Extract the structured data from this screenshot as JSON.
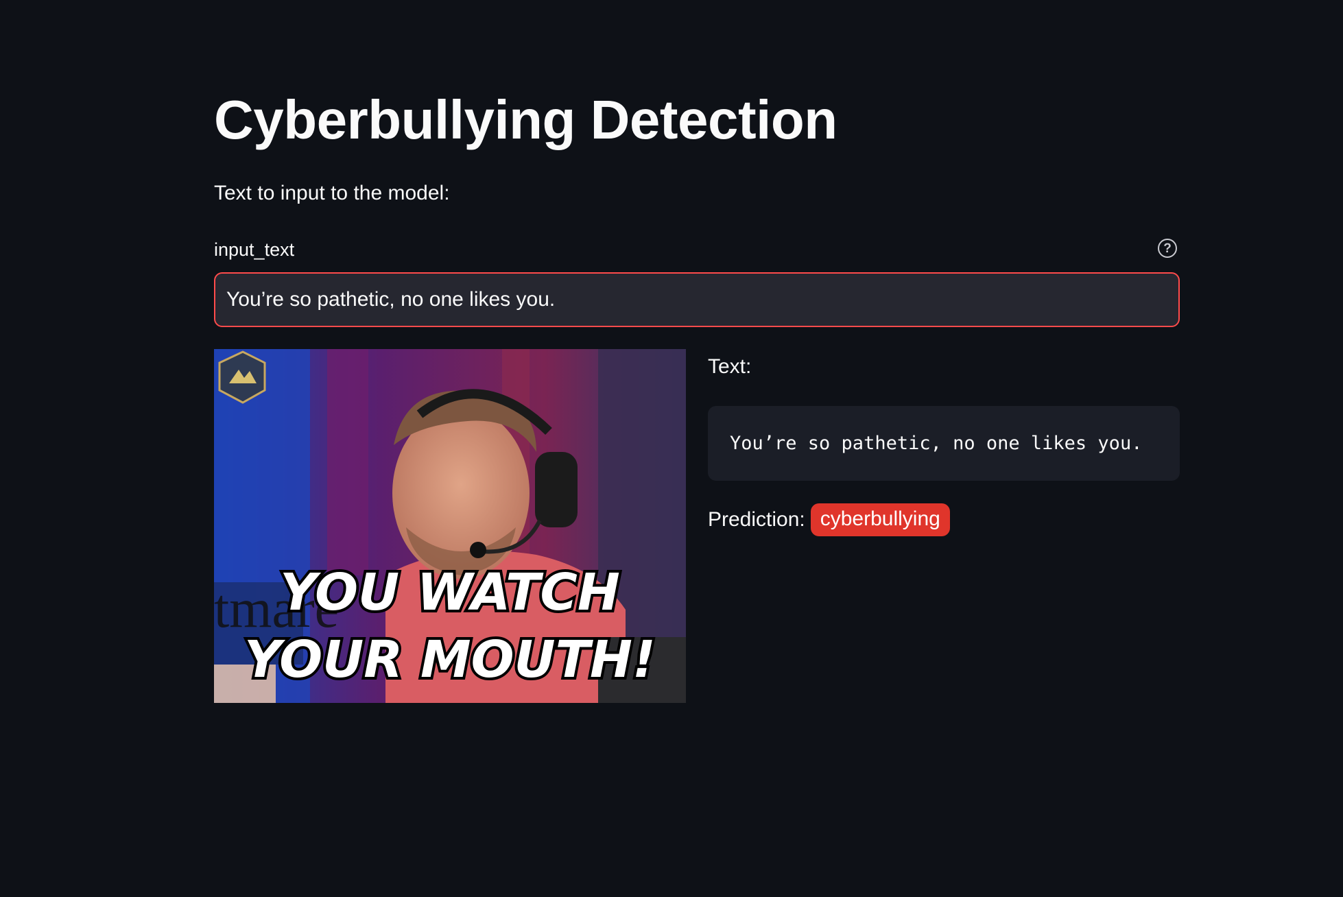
{
  "page": {
    "title": "Cyberbullying Detection",
    "intro": "Text to input to the model:"
  },
  "input": {
    "label": "input_text",
    "value": "You’re so pathetic, no one likes you.",
    "help_icon": "question-circle-icon"
  },
  "media": {
    "caption_line1": "YOU WATCH",
    "caption_line2": "YOUR MOUTH!",
    "background_text": "tmare"
  },
  "result": {
    "text_label": "Text:",
    "text_value": "You’re so pathetic, no one likes you.",
    "prediction_label": "Prediction:",
    "prediction_value": "cyberbullying",
    "prediction_color": "#e0352b"
  },
  "theme": {
    "background": "#0e1117",
    "input_border": "#ff4b4b",
    "input_bg": "#262730",
    "code_bg": "#1b1e27"
  }
}
